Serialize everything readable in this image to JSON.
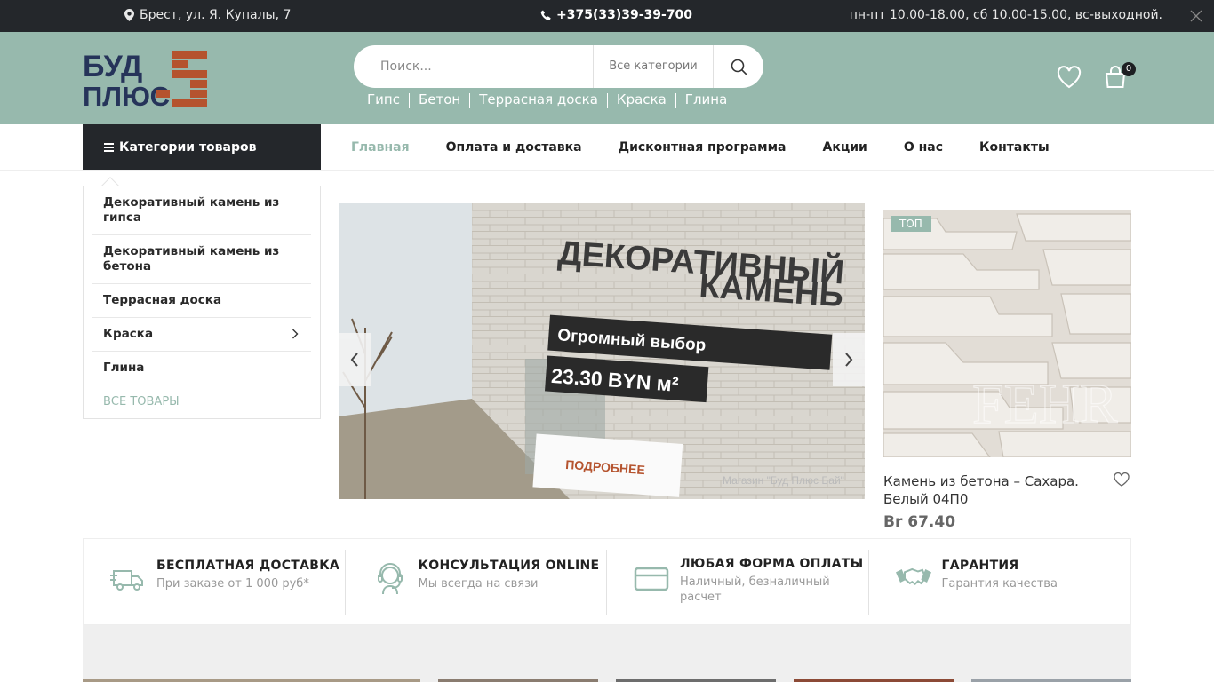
{
  "topbar": {
    "address": "Брест, ул. Я. Купалы, 7",
    "phone": "+375(33)39-39-700",
    "hours": "пн-пт 10.00-18.00, сб 10.00-15.00, вс-выходной."
  },
  "logo": {
    "line1": "БУД",
    "line2": "ПЛЮС"
  },
  "search": {
    "placeholder": "Поиск...",
    "category": "Все категории"
  },
  "quick_links": [
    "Гипс",
    "Бетон",
    "Террасная доска",
    "Краска",
    "Глина"
  ],
  "cart": {
    "count": "0"
  },
  "nav": {
    "categories_label": "Категории товаров",
    "items": [
      "Главная",
      "Оплата и доставка",
      "Дисконтная программа",
      "Акции",
      "О нас",
      "Контакты"
    ]
  },
  "categories": [
    "Декоративный камень из гипса",
    "Декоративный камень из бетона",
    "Террасная доска",
    "Краска",
    "Глина",
    "ВСЕ ТОВАРЫ"
  ],
  "slider": {
    "title1": "ДЕКОРАТИВНЫЙ",
    "title2": "КАМЕНЬ",
    "choice": "Огромный выбор",
    "price": "23.30 BYN м²",
    "cta": "ПОДРОБНЕЕ",
    "watermark": "Магазин \"Буд Плюс Бай\""
  },
  "product": {
    "badge": "ТОП",
    "name": "Камень из бетона – Сахара. Белый 04П0",
    "price": "Br 67.40"
  },
  "features": [
    {
      "title": "БЕСПЛАТНАЯ ДОСТАВКА",
      "sub": "При заказе от 1 000 руб*"
    },
    {
      "title": "КОНСУЛЬТАЦИЯ ONLINE",
      "sub": "Мы всегда на связи"
    },
    {
      "title": "ЛЮБАЯ ФОРМА ОПЛАТЫ",
      "sub": "Наличный, безналичный расчет"
    },
    {
      "title": "ГАРАНТИЯ",
      "sub": "Гарантия качества"
    }
  ],
  "colors": {
    "accent": "#97b9ad",
    "dark": "#24272b",
    "brick": "#b5532e",
    "navy": "#26345a"
  }
}
